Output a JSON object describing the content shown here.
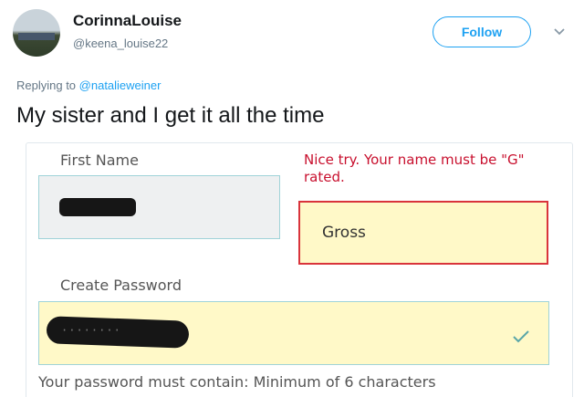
{
  "tweet": {
    "display_name": "CorinnaLouise",
    "handle": "@keena_louise22",
    "follow_label": "Follow",
    "reply_prefix": "Replying to ",
    "reply_mention": "@natalieweiner",
    "text": "My sister and I get it all the time"
  },
  "form": {
    "first_name_label": "First Name",
    "error_message": "Nice try. Your name must be \"G\" rated.",
    "nickname_value": "Gross",
    "password_label": "Create Password",
    "password_mask": "········",
    "password_hint": "Your password must contain: Minimum of 6 characters"
  },
  "colors": {
    "accent": "#1da1f2",
    "error": "#c8102e",
    "field_highlight": "#fff9c8",
    "success_check": "#5aa6a8"
  },
  "icons": {
    "caret": "chevron-down-icon",
    "check": "check-icon"
  }
}
